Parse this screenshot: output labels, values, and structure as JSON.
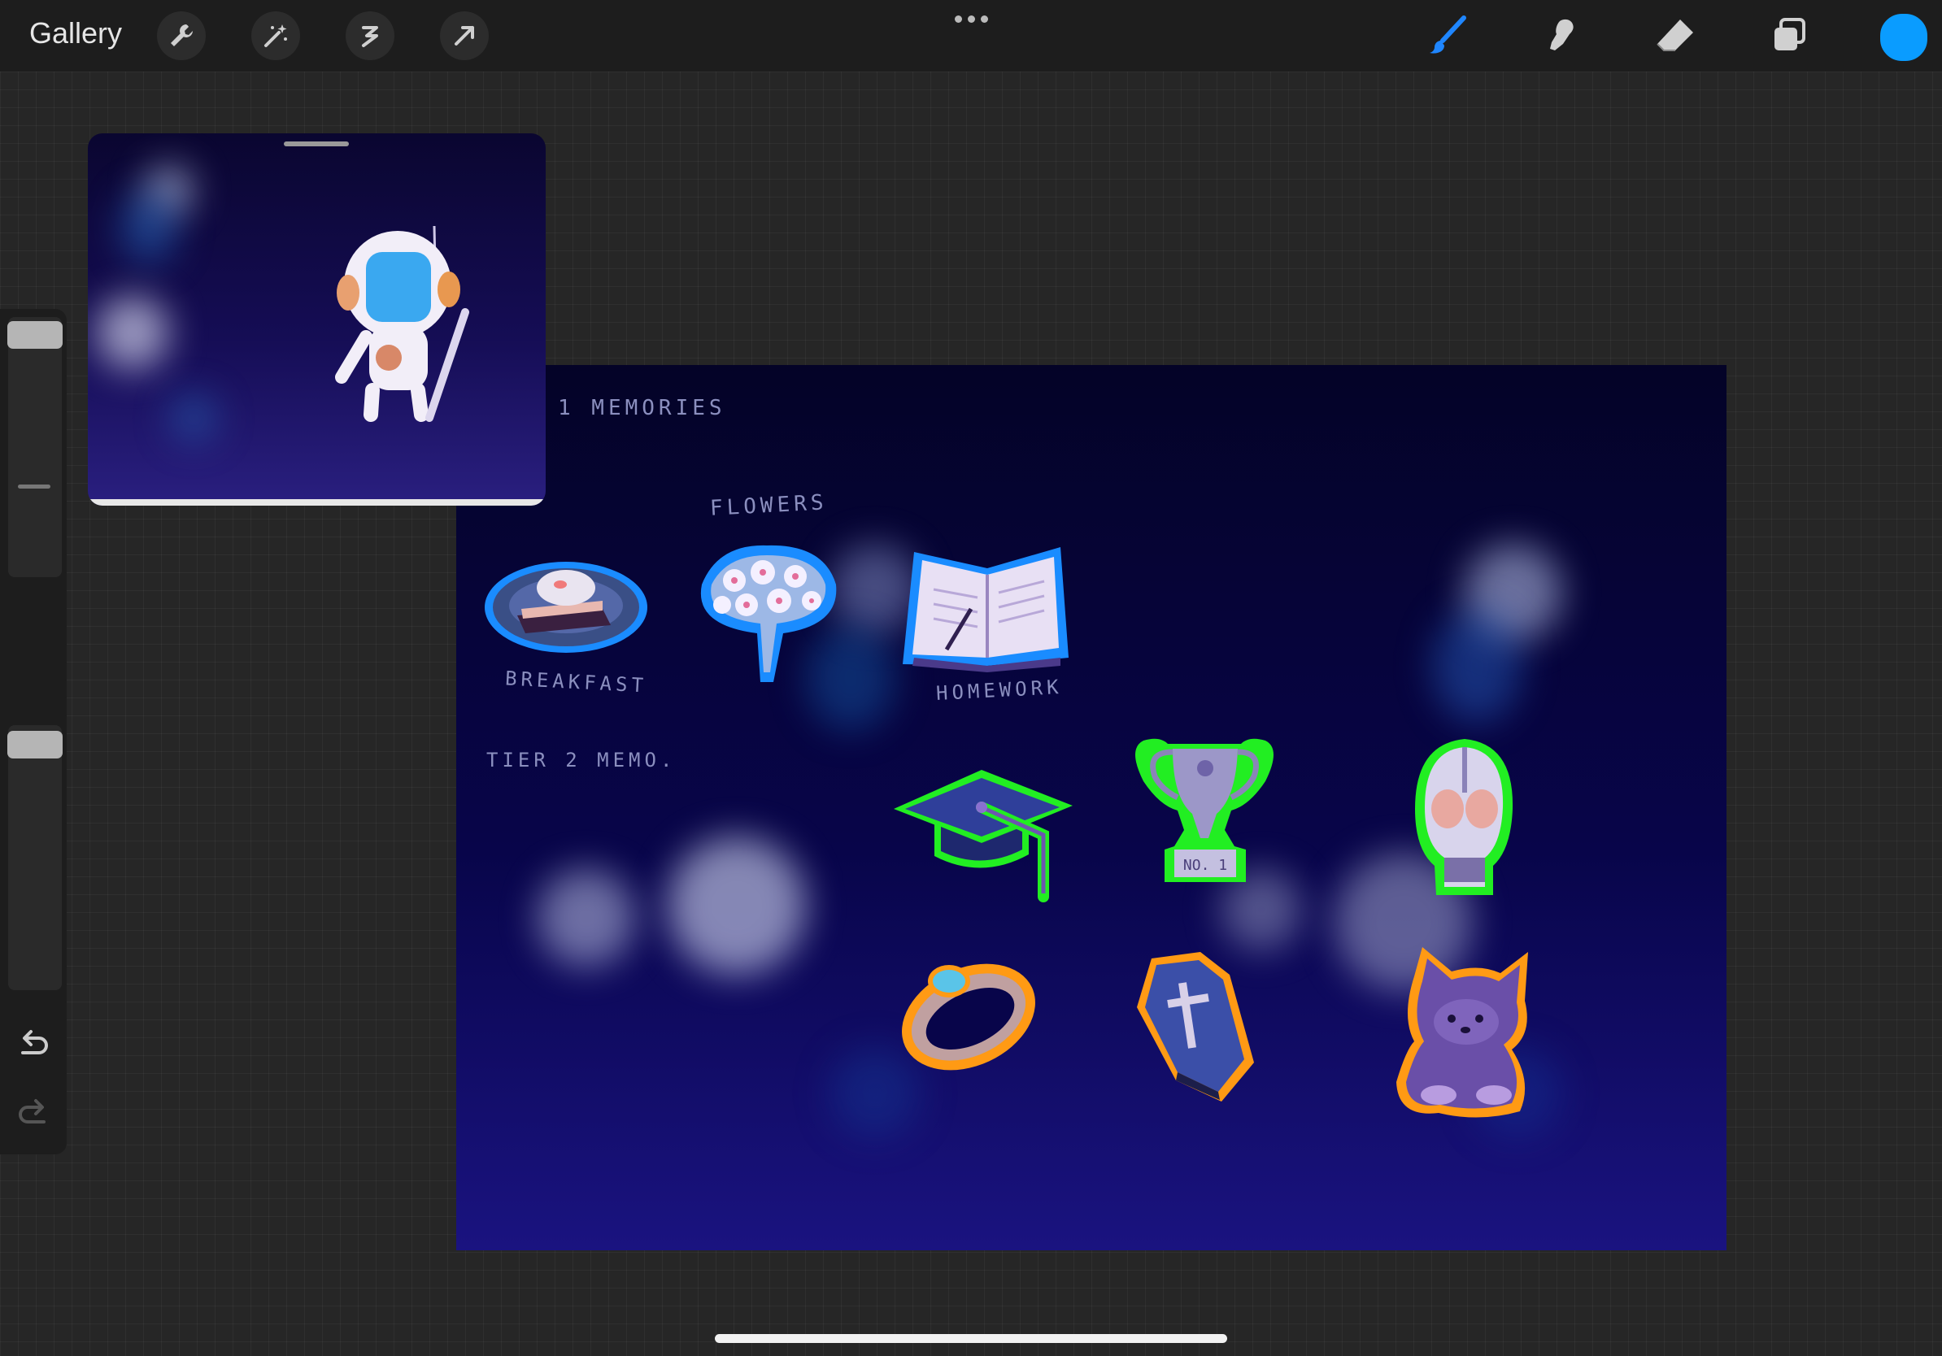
{
  "toolbar": {
    "gallery_label": "Gallery",
    "left_tools": [
      "wrench-icon",
      "magic-wand-icon",
      "selection-icon",
      "transform-arrow-icon"
    ],
    "right_tools": [
      "brush-icon",
      "smudge-icon",
      "eraser-icon",
      "layers-icon"
    ],
    "active_tool": "brush-icon",
    "current_color": "#0a9cff"
  },
  "canvas": {
    "labels": {
      "tier1": "1   MEMORIES",
      "flowers": "FLOWERS",
      "breakfast": "BREAKFAST",
      "homework": "HOMEWORK",
      "tier2": "TIER  2   MEMO.",
      "trophy_plate": "NO. 1"
    },
    "outline_colors": {
      "tier1": "#1a8cff",
      "tier2": "#22ee22",
      "tier3": "#ff9a14"
    },
    "stickers": [
      "breakfast",
      "flowers",
      "homework",
      "graduation-cap",
      "trophy",
      "helmet",
      "ring",
      "coffin",
      "cat"
    ]
  },
  "reference": {
    "subject": "astronaut"
  }
}
